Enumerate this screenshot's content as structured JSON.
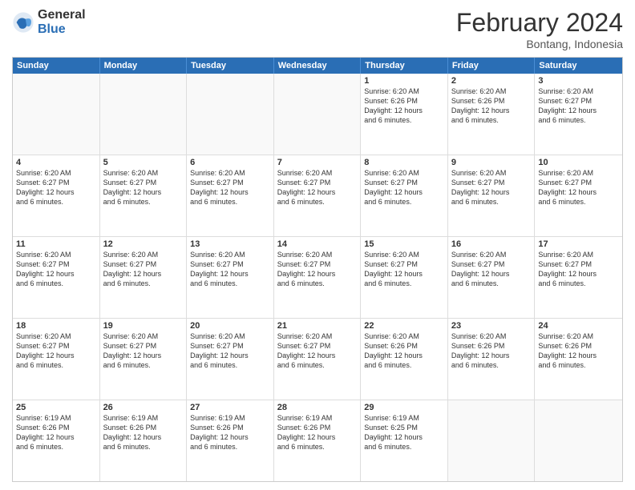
{
  "logo": {
    "general": "General",
    "blue": "Blue"
  },
  "header": {
    "month": "February 2024",
    "location": "Bontang, Indonesia"
  },
  "days": [
    "Sunday",
    "Monday",
    "Tuesday",
    "Wednesday",
    "Thursday",
    "Friday",
    "Saturday"
  ],
  "rows": [
    [
      {
        "day": "",
        "info": ""
      },
      {
        "day": "",
        "info": ""
      },
      {
        "day": "",
        "info": ""
      },
      {
        "day": "",
        "info": ""
      },
      {
        "day": "1",
        "info": "Sunrise: 6:20 AM\nSunset: 6:26 PM\nDaylight: 12 hours\nand 6 minutes."
      },
      {
        "day": "2",
        "info": "Sunrise: 6:20 AM\nSunset: 6:26 PM\nDaylight: 12 hours\nand 6 minutes."
      },
      {
        "day": "3",
        "info": "Sunrise: 6:20 AM\nSunset: 6:27 PM\nDaylight: 12 hours\nand 6 minutes."
      }
    ],
    [
      {
        "day": "4",
        "info": "Sunrise: 6:20 AM\nSunset: 6:27 PM\nDaylight: 12 hours\nand 6 minutes."
      },
      {
        "day": "5",
        "info": "Sunrise: 6:20 AM\nSunset: 6:27 PM\nDaylight: 12 hours\nand 6 minutes."
      },
      {
        "day": "6",
        "info": "Sunrise: 6:20 AM\nSunset: 6:27 PM\nDaylight: 12 hours\nand 6 minutes."
      },
      {
        "day": "7",
        "info": "Sunrise: 6:20 AM\nSunset: 6:27 PM\nDaylight: 12 hours\nand 6 minutes."
      },
      {
        "day": "8",
        "info": "Sunrise: 6:20 AM\nSunset: 6:27 PM\nDaylight: 12 hours\nand 6 minutes."
      },
      {
        "day": "9",
        "info": "Sunrise: 6:20 AM\nSunset: 6:27 PM\nDaylight: 12 hours\nand 6 minutes."
      },
      {
        "day": "10",
        "info": "Sunrise: 6:20 AM\nSunset: 6:27 PM\nDaylight: 12 hours\nand 6 minutes."
      }
    ],
    [
      {
        "day": "11",
        "info": "Sunrise: 6:20 AM\nSunset: 6:27 PM\nDaylight: 12 hours\nand 6 minutes."
      },
      {
        "day": "12",
        "info": "Sunrise: 6:20 AM\nSunset: 6:27 PM\nDaylight: 12 hours\nand 6 minutes."
      },
      {
        "day": "13",
        "info": "Sunrise: 6:20 AM\nSunset: 6:27 PM\nDaylight: 12 hours\nand 6 minutes."
      },
      {
        "day": "14",
        "info": "Sunrise: 6:20 AM\nSunset: 6:27 PM\nDaylight: 12 hours\nand 6 minutes."
      },
      {
        "day": "15",
        "info": "Sunrise: 6:20 AM\nSunset: 6:27 PM\nDaylight: 12 hours\nand 6 minutes."
      },
      {
        "day": "16",
        "info": "Sunrise: 6:20 AM\nSunset: 6:27 PM\nDaylight: 12 hours\nand 6 minutes."
      },
      {
        "day": "17",
        "info": "Sunrise: 6:20 AM\nSunset: 6:27 PM\nDaylight: 12 hours\nand 6 minutes."
      }
    ],
    [
      {
        "day": "18",
        "info": "Sunrise: 6:20 AM\nSunset: 6:27 PM\nDaylight: 12 hours\nand 6 minutes."
      },
      {
        "day": "19",
        "info": "Sunrise: 6:20 AM\nSunset: 6:27 PM\nDaylight: 12 hours\nand 6 minutes."
      },
      {
        "day": "20",
        "info": "Sunrise: 6:20 AM\nSunset: 6:27 PM\nDaylight: 12 hours\nand 6 minutes."
      },
      {
        "day": "21",
        "info": "Sunrise: 6:20 AM\nSunset: 6:27 PM\nDaylight: 12 hours\nand 6 minutes."
      },
      {
        "day": "22",
        "info": "Sunrise: 6:20 AM\nSunset: 6:26 PM\nDaylight: 12 hours\nand 6 minutes."
      },
      {
        "day": "23",
        "info": "Sunrise: 6:20 AM\nSunset: 6:26 PM\nDaylight: 12 hours\nand 6 minutes."
      },
      {
        "day": "24",
        "info": "Sunrise: 6:20 AM\nSunset: 6:26 PM\nDaylight: 12 hours\nand 6 minutes."
      }
    ],
    [
      {
        "day": "25",
        "info": "Sunrise: 6:19 AM\nSunset: 6:26 PM\nDaylight: 12 hours\nand 6 minutes."
      },
      {
        "day": "26",
        "info": "Sunrise: 6:19 AM\nSunset: 6:26 PM\nDaylight: 12 hours\nand 6 minutes."
      },
      {
        "day": "27",
        "info": "Sunrise: 6:19 AM\nSunset: 6:26 PM\nDaylight: 12 hours\nand 6 minutes."
      },
      {
        "day": "28",
        "info": "Sunrise: 6:19 AM\nSunset: 6:26 PM\nDaylight: 12 hours\nand 6 minutes."
      },
      {
        "day": "29",
        "info": "Sunrise: 6:19 AM\nSunset: 6:25 PM\nDaylight: 12 hours\nand 6 minutes."
      },
      {
        "day": "",
        "info": ""
      },
      {
        "day": "",
        "info": ""
      }
    ]
  ]
}
